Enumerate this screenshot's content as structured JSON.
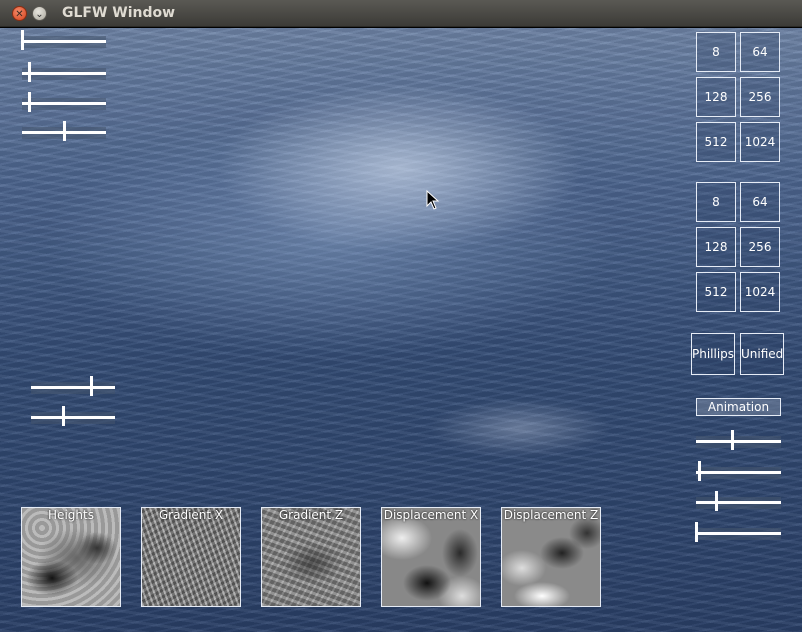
{
  "window": {
    "title": "GLFW Window",
    "close_glyph": "✕",
    "minimize_glyph": "⌄"
  },
  "sliders": {
    "top_left": [
      {
        "name": "slider-1",
        "value": 0.0
      },
      {
        "name": "slider-2",
        "value": 0.08
      },
      {
        "name": "slider-3",
        "value": 0.08
      },
      {
        "name": "slider-4",
        "value": 0.5
      }
    ],
    "mid_left": [
      {
        "name": "slider-5",
        "value": 0.72
      },
      {
        "name": "slider-6",
        "value": 0.38
      }
    ],
    "right": [
      {
        "name": "slider-7",
        "value": 0.42
      },
      {
        "name": "slider-8",
        "value": 0.03
      },
      {
        "name": "slider-9",
        "value": 0.24
      },
      {
        "name": "slider-10",
        "value": 0.0
      }
    ]
  },
  "resolution_group_1": [
    "8",
    "64",
    "128",
    "256",
    "512",
    "1024"
  ],
  "resolution_group_2": [
    "8",
    "64",
    "128",
    "256",
    "512",
    "1024"
  ],
  "spectrum": {
    "phillips": "Phillips",
    "unified": "Unified"
  },
  "animation_label": "Animation",
  "textures": [
    "Heights",
    "Gradient X",
    "Gradient Z",
    "Displacement X",
    "Displacement Z"
  ]
}
